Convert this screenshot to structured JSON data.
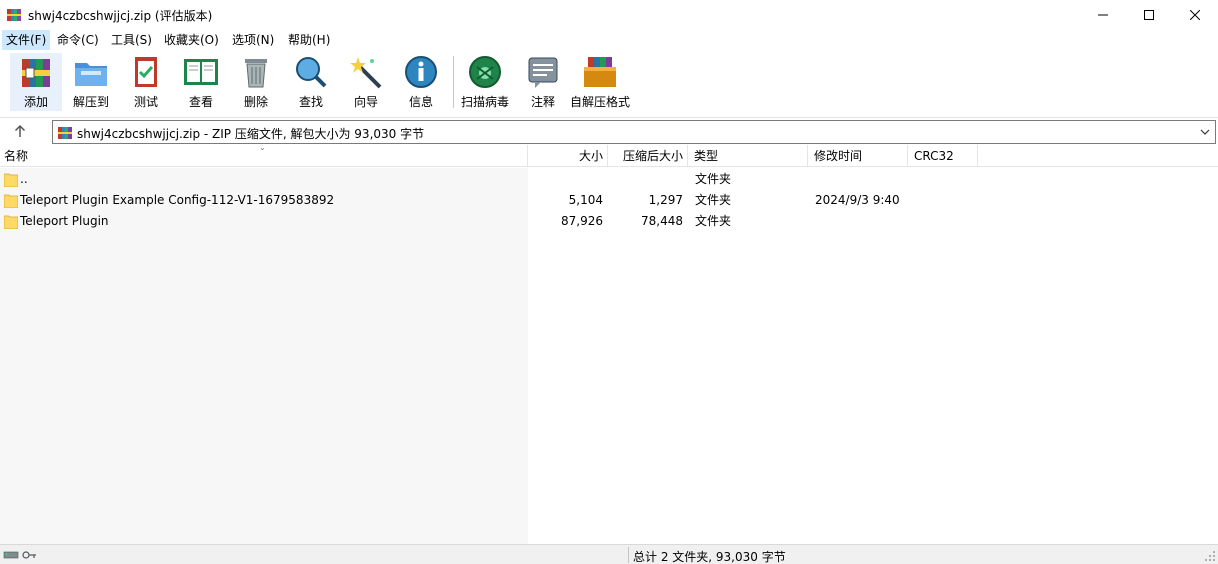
{
  "window": {
    "title": "shwj4czbcshwjjcj.zip (评估版本)"
  },
  "menu": [
    {
      "label": "文件(F)"
    },
    {
      "label": "命令(C)"
    },
    {
      "label": "工具(S)"
    },
    {
      "label": "收藏夹(O)"
    },
    {
      "label": "选项(N)"
    },
    {
      "label": "帮助(H)"
    }
  ],
  "toolbar": [
    {
      "label": "添加",
      "icon": "add-archive-icon"
    },
    {
      "label": "解压到",
      "icon": "extract-to-icon"
    },
    {
      "label": "测试",
      "icon": "test-icon"
    },
    {
      "label": "查看",
      "icon": "view-icon"
    },
    {
      "label": "删除",
      "icon": "delete-icon"
    },
    {
      "label": "查找",
      "icon": "find-icon"
    },
    {
      "label": "向导",
      "icon": "wizard-icon"
    },
    {
      "label": "信息",
      "icon": "info-icon"
    },
    {
      "label": "扫描病毒",
      "icon": "virus-scan-icon"
    },
    {
      "label": "注释",
      "icon": "comment-icon"
    },
    {
      "label": "自解压格式",
      "icon": "sfx-icon"
    }
  ],
  "address": {
    "path_text": "shwj4czbcshwjjcj.zip - ZIP 压缩文件, 解包大小为 93,030 字节"
  },
  "columns": {
    "name": "名称",
    "size": "大小",
    "packed": "压缩后大小",
    "type": "类型",
    "modified": "修改时间",
    "crc": "CRC32"
  },
  "files": [
    {
      "name": "..",
      "size": "",
      "packed": "",
      "type": "文件夹",
      "modified": "",
      "crc": ""
    },
    {
      "name": "Teleport Plugin Example Config-112-V1-1679583892",
      "size": "5,104",
      "packed": "1,297",
      "type": "文件夹",
      "modified": "2024/9/3 9:40",
      "crc": ""
    },
    {
      "name": "Teleport Plugin",
      "size": "87,926",
      "packed": "78,448",
      "type": "文件夹",
      "modified": "",
      "crc": ""
    }
  ],
  "status": {
    "summary": "总计 2 文件夹, 93,030 字节"
  },
  "colors": {
    "menu_active": "#cce8ff",
    "list_bg": "#f7f7f7",
    "folder": "#ffd966"
  }
}
